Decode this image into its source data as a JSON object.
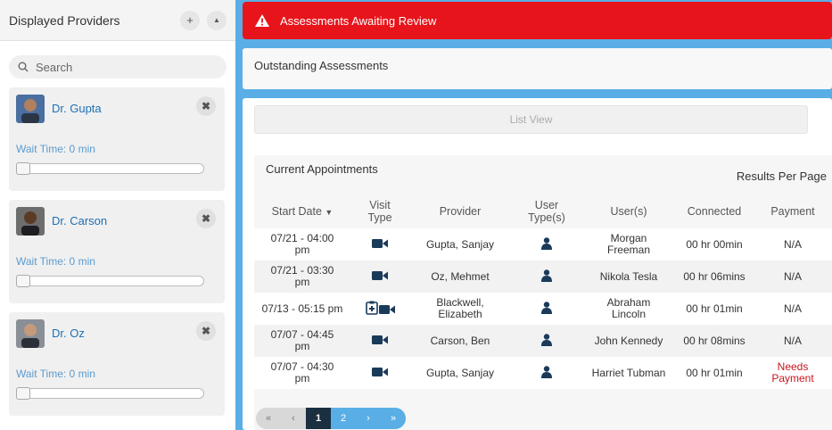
{
  "sidebar": {
    "title": "Displayed Providers",
    "search_placeholder": "Search",
    "providers": [
      {
        "name": "Dr. Gupta",
        "wait": "Wait Time: 0 min",
        "wait_level": 0
      },
      {
        "name": "Dr. Carson",
        "wait": "Wait Time: 0 min",
        "wait_level": 0
      },
      {
        "name": "Dr. Oz",
        "wait": "Wait Time: 0 min",
        "wait_level": 0
      }
    ]
  },
  "alert": {
    "text": "Assessments Awaiting Review",
    "color": "#e8141b"
  },
  "outstanding": {
    "title": "Outstanding Assessments"
  },
  "list_view_label": "List View",
  "appointments": {
    "title": "Current Appointments",
    "results_per_page": "Results Per Page",
    "columns": [
      "Start Date",
      "Visit Type",
      "Provider",
      "User Type(s)",
      "User(s)",
      "Connected",
      "Payment"
    ],
    "rows": [
      {
        "date": "07/21 - 04:00 pm",
        "visit": "video",
        "provider": "Gupta, Sanjay",
        "user": "Morgan Freeman",
        "connected": "00 hr 00min",
        "payment": "N/A"
      },
      {
        "date": "07/21 - 03:30 pm",
        "visit": "video",
        "provider": "Oz, Mehmet",
        "user": "Nikola Tesla",
        "connected": "00 hr 06mins",
        "payment": "N/A"
      },
      {
        "date": "07/13 - 05:15 pm",
        "visit": "clinic-video",
        "provider": "Blackwell, Elizabeth",
        "user": "Abraham Lincoln",
        "connected": "00 hr 01min",
        "payment": "N/A"
      },
      {
        "date": "07/07 - 04:45 pm",
        "visit": "video",
        "provider": "Carson, Ben",
        "user": "John Kennedy",
        "connected": "00 hr 08mins",
        "payment": "N/A"
      },
      {
        "date": "07/07 - 04:30 pm",
        "visit": "video",
        "provider": "Gupta, Sanjay",
        "user": "Harriet Tubman",
        "connected": "00 hr 01min",
        "payment": "Needs Payment"
      }
    ]
  },
  "pagination": {
    "first": "«",
    "prev": "‹",
    "pages": [
      "1",
      "2"
    ],
    "next": "›",
    "last": "»",
    "current": "1"
  }
}
